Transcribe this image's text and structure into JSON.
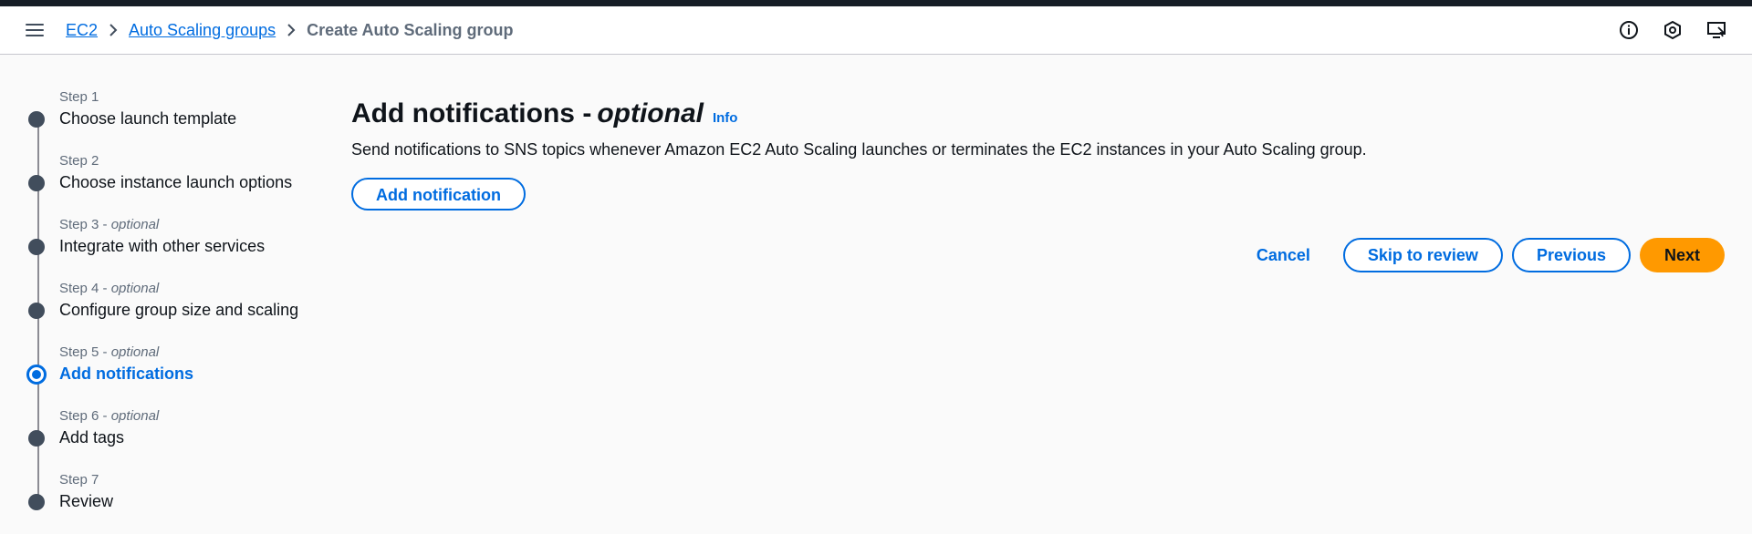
{
  "header": {
    "breadcrumbs": [
      "EC2",
      "Auto Scaling groups"
    ],
    "current": "Create Auto Scaling group",
    "icons": [
      "info-circle-icon",
      "settings-hexagon-icon",
      "feedback-screen-icon"
    ]
  },
  "steps": [
    {
      "label": "Step 1",
      "optional": "",
      "title": "Choose launch template",
      "state": "complete"
    },
    {
      "label": "Step 2",
      "optional": "",
      "title": "Choose instance launch options",
      "state": "complete"
    },
    {
      "label": "Step 3",
      "optional": "optional",
      "title": "Integrate with other services",
      "state": "complete"
    },
    {
      "label": "Step 4",
      "optional": "optional",
      "title": "Configure group size and scaling",
      "state": "complete"
    },
    {
      "label": "Step 5",
      "optional": "optional",
      "title": "Add notifications",
      "state": "active"
    },
    {
      "label": "Step 6",
      "optional": "optional",
      "title": "Add tags",
      "state": "pending"
    },
    {
      "label": "Step 7",
      "optional": "",
      "title": "Review",
      "state": "pending"
    }
  ],
  "main": {
    "title": "Add notifications -",
    "title_optional": "optional",
    "info": "Info",
    "description": "Send notifications to SNS topics whenever Amazon EC2 Auto Scaling launches or terminates the EC2 instances in your Auto Scaling group.",
    "add_button": "Add notification"
  },
  "actions": {
    "cancel": "Cancel",
    "skip": "Skip to review",
    "previous": "Previous",
    "next": "Next"
  },
  "colors": {
    "link": "#006ce0",
    "primary": "#ff9900",
    "header_bar": "#161d26"
  }
}
